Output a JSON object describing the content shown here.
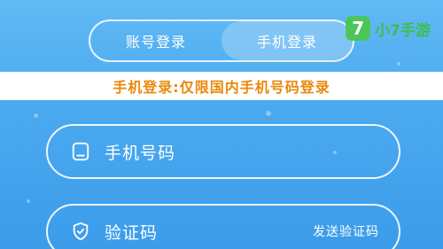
{
  "tabs": [
    {
      "label": "账号登录",
      "active": false
    },
    {
      "label": "手机登录",
      "active": true
    }
  ],
  "notice": "手机登录:仅限国内手机号码登录",
  "form": {
    "phone_placeholder": "手机号码",
    "code_placeholder": "验证码",
    "send_code_label": "发送验证码"
  },
  "watermark": {
    "logo_glyph": "7",
    "text": "小7手游"
  },
  "colors": {
    "background_top": "#61b9f4",
    "background_bottom": "#3c9cea",
    "notice_text": "#e9890b",
    "watermark_green": "#4cc55a"
  }
}
